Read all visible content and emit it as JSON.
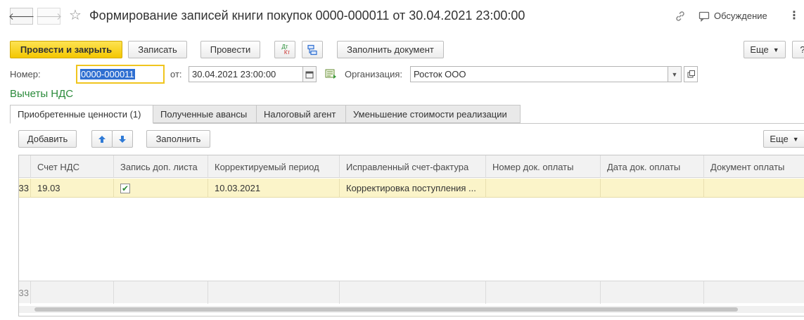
{
  "window": {
    "back_icon": "arrow-left-icon",
    "forward_icon": "arrow-right-icon",
    "title": "Формирование записей книги покупок 0000-000011 от 30.04.2021 23:00:00",
    "discussion_label": "Обсуждение",
    "more_icon": "vertical-dots-icon"
  },
  "toolbar": {
    "post_close_label": "Провести и закрыть",
    "save_label": "Записать",
    "post_label": "Провести",
    "dt_kt_icon": "dt-kt-icon",
    "dt_label": "Дт",
    "kt_label": "Кт",
    "structure_icon": "document-structure-icon",
    "fill_doc_label": "Заполнить документ",
    "more_label": "Еще",
    "help_label": "?"
  },
  "form": {
    "number_label": "Номер:",
    "number_value": "0000-000011",
    "date_label": "от:",
    "date_value": "30.04.2021 23:00:00",
    "org_label": "Организация:",
    "org_value": "Росток ООО"
  },
  "section_title": "Вычеты НДС",
  "tabs": [
    {
      "label": "Приобретенные ценности (1)",
      "active": true
    },
    {
      "label": "Полученные авансы",
      "active": false
    },
    {
      "label": "Налоговый агент",
      "active": false
    },
    {
      "label": "Уменьшение стоимости реализации",
      "active": false
    }
  ],
  "table_toolbar": {
    "add_label": "Добавить",
    "up_icon": "arrow-up-icon",
    "down_icon": "arrow-down-icon",
    "fill_label": "Заполнить",
    "more_label": "Еще"
  },
  "table": {
    "first_col_fragment": "33",
    "columns": [
      "Счет НДС",
      "Запись доп. листа",
      "Корректируемый период",
      "Исправленный счет-фактура",
      "Номер док. оплаты",
      "Дата док. оплаты",
      "Документ оплаты"
    ],
    "rows": [
      {
        "first": "33",
        "account": "19.03",
        "additional_sheet": true,
        "period": "10.03.2021",
        "invoice": "Корректировка поступления ...",
        "payment_number": "",
        "payment_date": "",
        "payment_doc": ""
      }
    ],
    "footer_fragment": "33"
  },
  "colors": {
    "primary_button": "#f4c700",
    "section_title": "#2a8a3a",
    "selected_row": "#fbf4c9",
    "selection": "#2f6fd1"
  }
}
